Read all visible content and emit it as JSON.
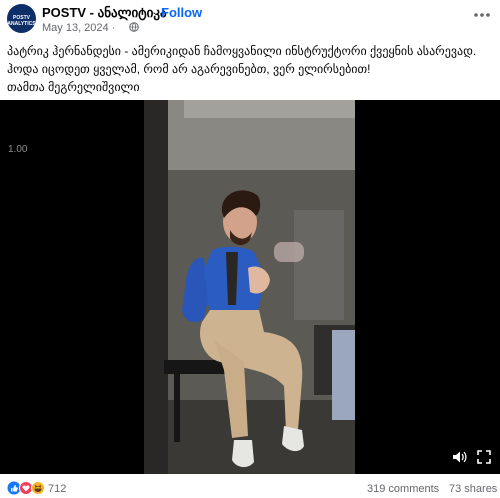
{
  "header": {
    "page_name": "POSTV - ანალიტიკა",
    "separator": "·",
    "follow_label": "Follow",
    "date": "May 13, 2024",
    "date_separator": "·",
    "avatar_text": "POSTV ANALYTICS",
    "more_icon": "more-horizontal-icon",
    "privacy_icon": "globe-icon"
  },
  "caption": {
    "line1": "პატრიკ ჰერნანდესი - ამერიკიდან ჩამოყვანილი ინსტრუქტორი ქვეყნის ასარევად.",
    "line2": "ჰოდა იცოდეთ ყველამ, რომ არ აგარევინებთ, ვერ ელირსებით!",
    "line3": "თამთა მეგრელიშვილი"
  },
  "video": {
    "timestamp": "1.00",
    "controls": [
      "play-icon",
      "volume-icon",
      "fullscreen-icon"
    ]
  },
  "footer": {
    "reactions": [
      "like-icon",
      "love-icon",
      "haha-icon"
    ],
    "reaction_count": "712",
    "comments": "319 comments",
    "shares": "73 shares"
  },
  "colors": {
    "link": "#0866ff",
    "muted": "#65676b",
    "text": "#050505",
    "video_bg": "#000000"
  }
}
